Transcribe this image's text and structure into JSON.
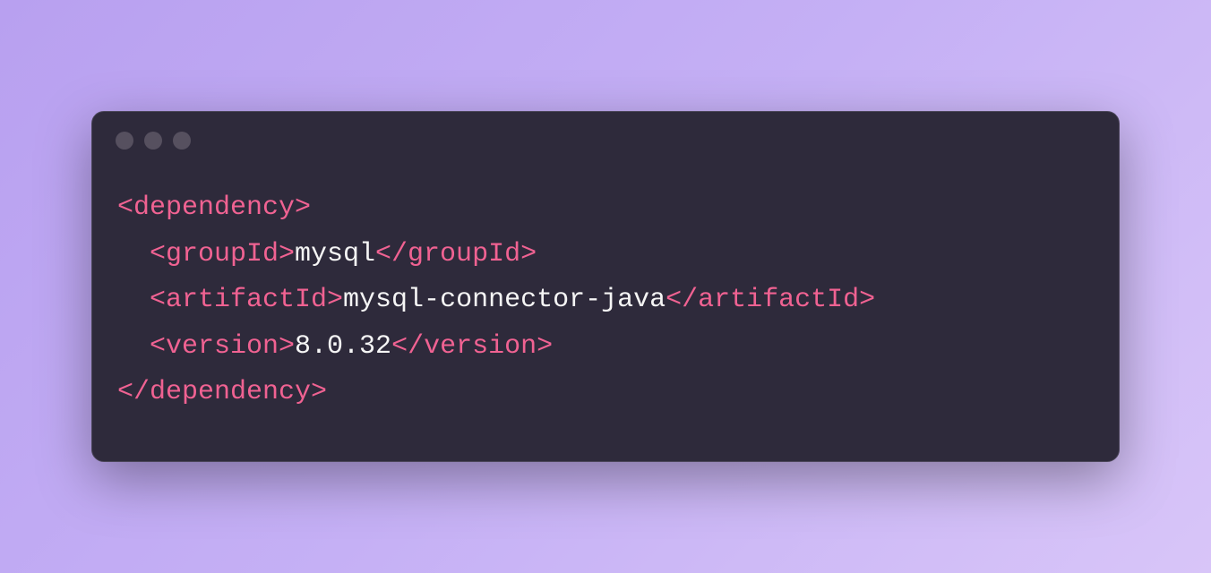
{
  "code": {
    "tags": {
      "dependency_open": "<dependency>",
      "dependency_close": "</dependency>",
      "groupId_open": "<groupId>",
      "groupId_close": "</groupId>",
      "artifactId_open": "<artifactId>",
      "artifactId_close": "</artifactId>",
      "version_open": "<version>",
      "version_close": "</version>"
    },
    "values": {
      "groupId": "mysql",
      "artifactId": "mysql-connector-java",
      "version": "8.0.32"
    }
  }
}
